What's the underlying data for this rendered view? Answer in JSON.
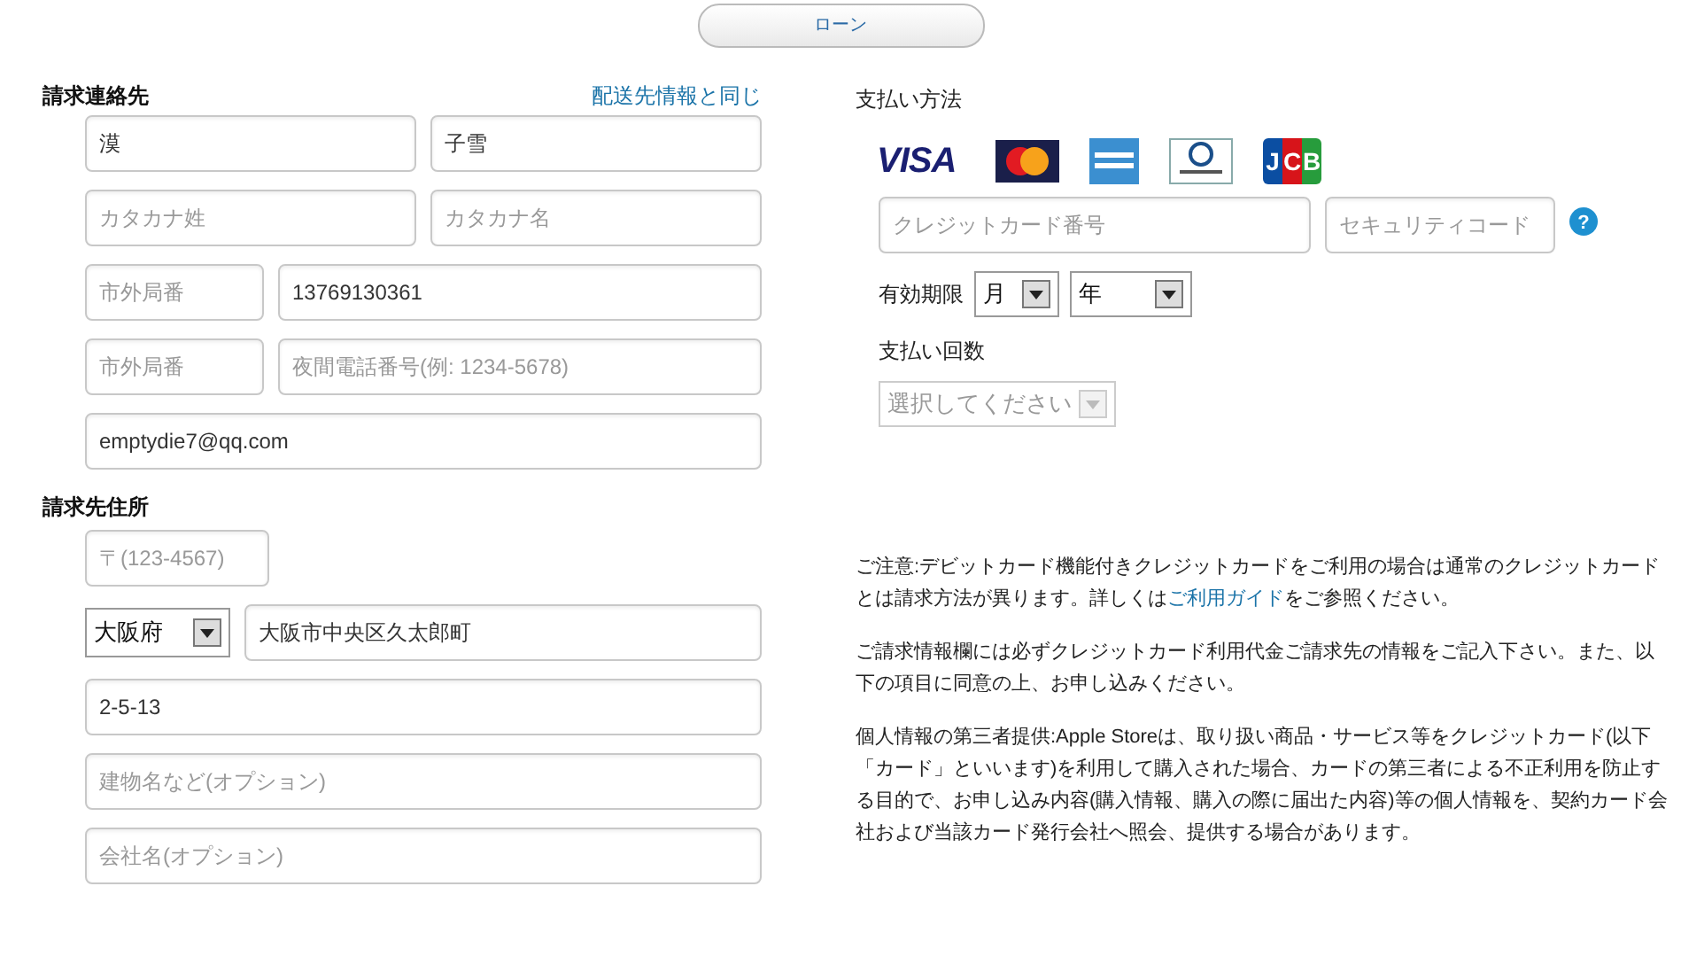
{
  "top_button": "ローン",
  "billing_contact": {
    "title": "請求連絡先",
    "same_as_link": "配送先情報と同じ",
    "rows": [
      [
        {
          "value": "漠"
        },
        {
          "value": "子雪"
        }
      ],
      [
        {
          "placeholder": "カタカナ姓"
        },
        {
          "placeholder": "カタカナ名"
        }
      ],
      [
        {
          "placeholder": "市外局番",
          "kind": "short"
        },
        {
          "value": "13769130361"
        }
      ],
      [
        {
          "placeholder": "市外局番",
          "kind": "short"
        },
        {
          "placeholder": "夜間電話番号(例: 1234-5678)"
        }
      ],
      [
        {
          "value": "emptydie7@qq.com"
        }
      ]
    ]
  },
  "billing_address": {
    "title": "請求先住所",
    "postal": {
      "placeholder": "〒(123-4567)"
    },
    "prefecture": "大阪府",
    "city": {
      "value": "大阪市中央区久太郎町"
    },
    "lines": [
      {
        "value": "2-5-13"
      },
      {
        "placeholder": "建物名など(オプション)"
      },
      {
        "placeholder": "会社名(オプション)"
      }
    ]
  },
  "payment": {
    "title": "支払い方法",
    "cards": [
      {
        "kind": "visa",
        "label": "VISA"
      },
      {
        "kind": "mastercard"
      },
      {
        "kind": "amex"
      },
      {
        "kind": "diners"
      },
      {
        "kind": "jcb",
        "label": "JCB"
      }
    ],
    "help_icon": "?",
    "card_number": {
      "placeholder": "クレジットカード番号"
    },
    "security_code": {
      "placeholder": "セキュリティコード"
    },
    "expiry_label": "有効期限",
    "month": "月",
    "year": "年",
    "installments_label": "支払い回数",
    "installments": {
      "value": "選択してください",
      "disabled": true
    }
  },
  "notes": [
    {
      "parts": [
        {
          "text": "ご注意:デビットカード機能付きクレジットカードをご利用の場合は通常のクレジットカードとは請求方法が異ります。詳しくは"
        },
        {
          "text": "ご利用ガイド",
          "link": true
        },
        {
          "text": "をご参照ください。"
        }
      ]
    },
    {
      "parts": [
        {
          "text": "ご請求情報欄には必ずクレジットカード利用代金ご請求先の情報をご記入下さい。また、以下の項目に同意の上、お申し込みください。"
        }
      ]
    },
    {
      "parts": [
        {
          "text": "個人情報の第三者提供:Apple Storeは、取り扱い商品・サービス等をクレジットカード(以下「カード」といいます)を利用して購入された場合、カードの第三者による不正利用を防止する目的で、お申し込み内容(購入情報、購入の際に届出た内容)等の個人情報を、契約カード会社および当該カード発行会社へ照会、提供する場合があります。"
        }
      ]
    }
  ]
}
